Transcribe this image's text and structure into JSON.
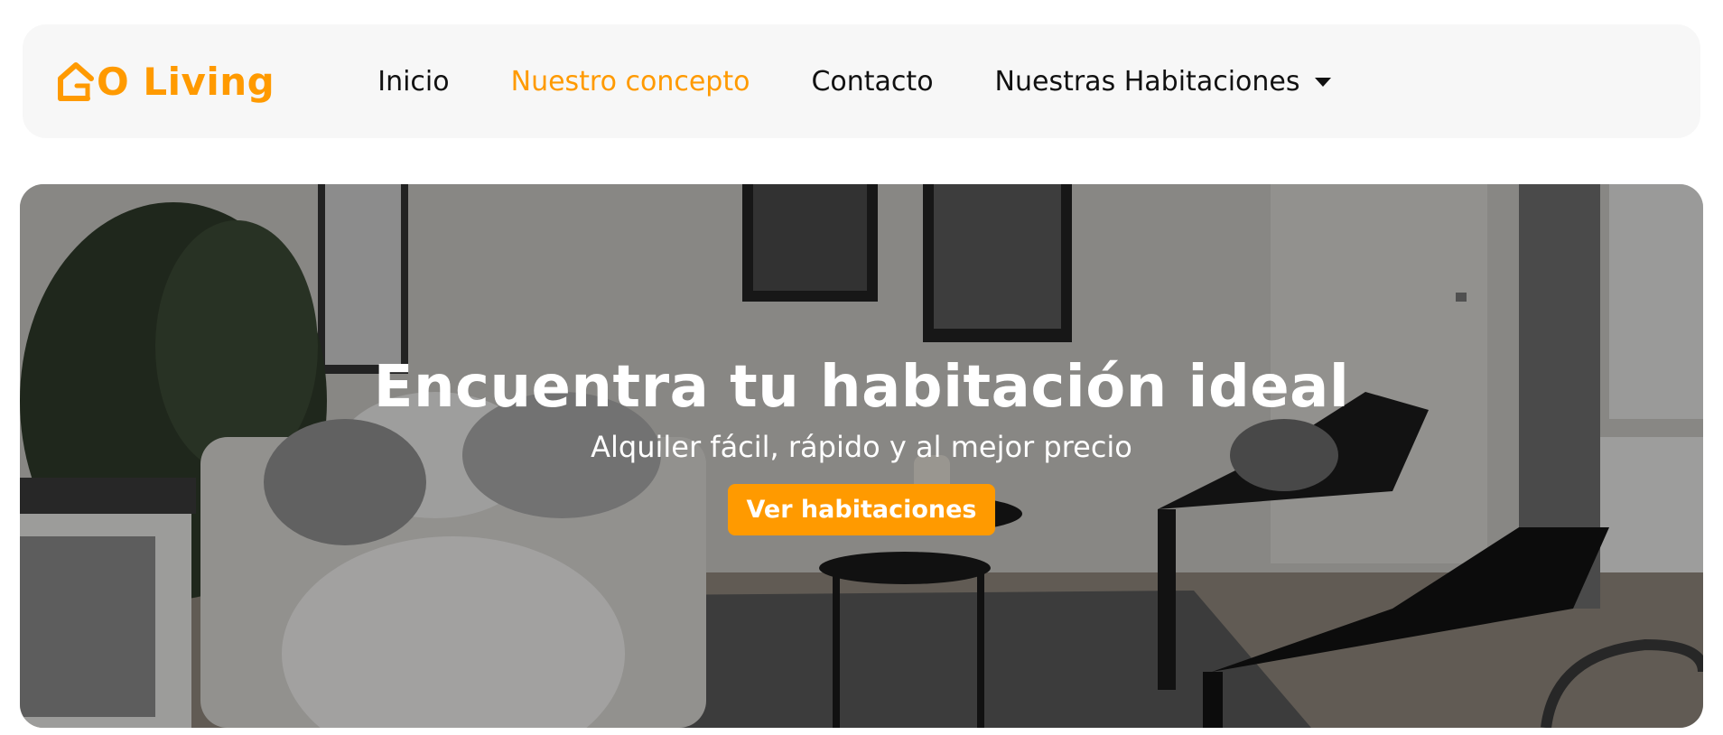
{
  "brand": {
    "name": "O Living",
    "color": "#ff9a00",
    "logo_icon": "house-icon"
  },
  "nav": {
    "items": [
      {
        "label": "Inicio",
        "active": false
      },
      {
        "label": "Nuestro concepto",
        "active": true
      },
      {
        "label": "Contacto",
        "active": false
      },
      {
        "label": "Nuestras Habitaciones",
        "active": false,
        "dropdown": true
      }
    ],
    "dropdown_icon": "chevron-down-icon"
  },
  "hero": {
    "title": "Encuentra tu habitación ideal",
    "subtitle": "Alquiler fácil, rápido y al mejor precio",
    "button_label": "Ver habitaciones",
    "background": "living-room-photo"
  },
  "colors": {
    "accent": "#ff9a00",
    "navbar_bg": "#f7f7f7",
    "text": "#111111"
  }
}
